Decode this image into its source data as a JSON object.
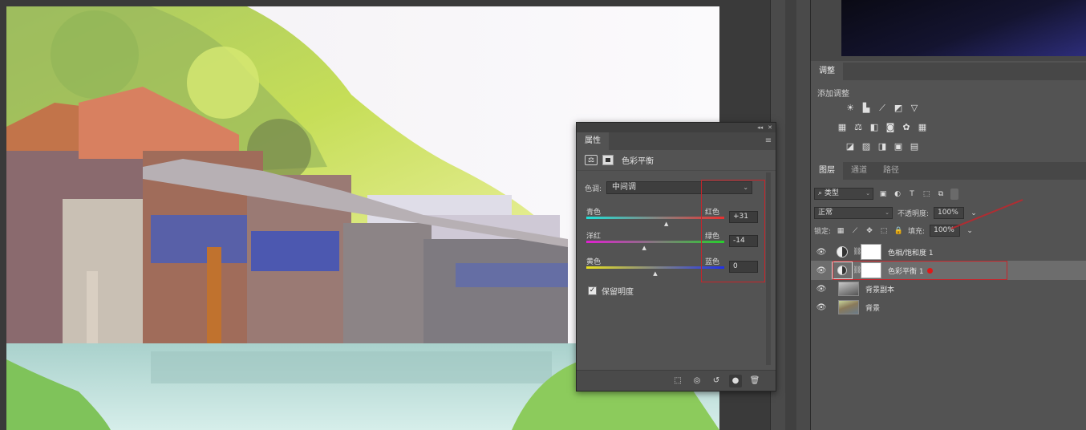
{
  "properties_panel": {
    "tab_title": "属性",
    "menu_icon": "menu-icon",
    "adjustment_name": "色彩平衡",
    "tone_label": "色调:",
    "tone_value": "中间调",
    "sliders": [
      {
        "left_label": "青色",
        "right_label": "红色",
        "value": "+31",
        "position": 0.58,
        "field": "+31"
      },
      {
        "left_label": "洋红",
        "right_label": "绿色",
        "value": -14,
        "position": 0.42,
        "field": "-14"
      },
      {
        "left_label": "黄色",
        "right_label": "蓝色",
        "value": 0,
        "position": 0.5,
        "field": "0"
      }
    ],
    "preserve_luminosity": {
      "checked": true,
      "label": "保留明度"
    },
    "footer_icons": [
      "clip-to-layer-icon",
      "view-previous-icon",
      "reset-icon",
      "visibility-icon",
      "delete-icon"
    ]
  },
  "dock": {
    "adjustments_tabs": [
      {
        "label": "调整",
        "active": true
      }
    ],
    "adjustments_title": "添加调整",
    "layers_tabs": [
      {
        "label": "图层",
        "active": true
      },
      {
        "label": "通道",
        "active": false
      },
      {
        "label": "路径",
        "active": false
      }
    ],
    "filter_kind": "类型",
    "blend_mode": "正常",
    "opacity_label": "不透明度:",
    "opacity_value": "100%",
    "lock_label": "锁定:",
    "fill_label": "填充:",
    "fill_value": "100%",
    "layers": [
      {
        "name": "色相/饱和度 1",
        "type": "adjustment",
        "selected": false
      },
      {
        "name": "色彩平衡 1",
        "type": "adjustment",
        "selected": true
      },
      {
        "name": "背景副本",
        "type": "pixel",
        "selected": false
      },
      {
        "name": "背景",
        "type": "background",
        "selected": false
      }
    ]
  },
  "colors": {
    "highlight_red": "#c8242a",
    "panel_bg": "#535353",
    "app_bg": "#3c3c3c"
  }
}
